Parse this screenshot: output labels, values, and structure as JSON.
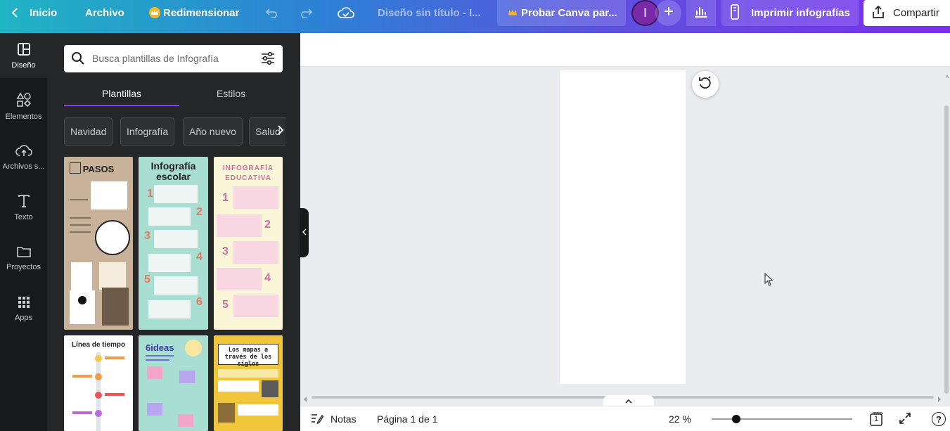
{
  "topbar": {
    "home_label": "Inicio",
    "file_label": "Archivo",
    "resize_label": "Redimensionar",
    "doc_title": "Diseño sin título - I...",
    "try_label": "Probar Canva par...",
    "avatar_initial": "I",
    "print_label": "Imprimir infografías",
    "share_label": "Compartir",
    "icons": [
      "chevron-left-icon",
      "crown-icon",
      "undo-icon",
      "redo-icon",
      "cloud-check-icon",
      "plus-icon",
      "bar-chart-icon",
      "print-icon",
      "share-icon"
    ]
  },
  "rail": {
    "items": [
      {
        "label": "Diseño",
        "icon": "layout-icon",
        "active": true
      },
      {
        "label": "Elementos",
        "icon": "shapes-icon"
      },
      {
        "label": "Archivos s...",
        "icon": "cloud-upload-icon"
      },
      {
        "label": "Texto",
        "icon": "text-icon"
      },
      {
        "label": "Proyectos",
        "icon": "folder-icon"
      },
      {
        "label": "Apps",
        "icon": "apps-grid-icon"
      }
    ]
  },
  "panel": {
    "search_placeholder": "Busca plantillas de Infografía",
    "tabs": [
      {
        "label": "Plantillas",
        "active": true
      },
      {
        "label": "Estilos"
      }
    ],
    "chips": [
      "Navidad",
      "Infografía",
      "Año nuevo",
      "Salud"
    ],
    "templates": [
      {
        "title": "PASOS",
        "bg": "#c9b29a"
      },
      {
        "title": "Infografía escolar",
        "bg": "#a9ded2",
        "numbers": [
          "1",
          "2",
          "3",
          "4",
          "5",
          "6"
        ]
      },
      {
        "title": "INFOGRAFÍA EDUCATIVA",
        "bg": "#fbf6d8",
        "numbers": [
          "1",
          "2",
          "3",
          "4",
          "5"
        ]
      },
      {
        "title": "Línea de tiempo",
        "bg": "#ffffff"
      },
      {
        "title": "6ideas",
        "bg": "#a9ded2"
      },
      {
        "title": "Los mapas a través de los siglos",
        "bg": "#f2c63a"
      }
    ]
  },
  "canvas": {
    "page_bg": "#ffffff"
  },
  "footer": {
    "notes_label": "Notas",
    "page_label": "Página 1 de 1",
    "zoom_label": "22 %",
    "zoom_level": 0.22,
    "page_count": "1",
    "help_label": "?"
  },
  "colors": {
    "accent": "#8b3dff",
    "panel": "#252627",
    "rail": "#18191b"
  }
}
